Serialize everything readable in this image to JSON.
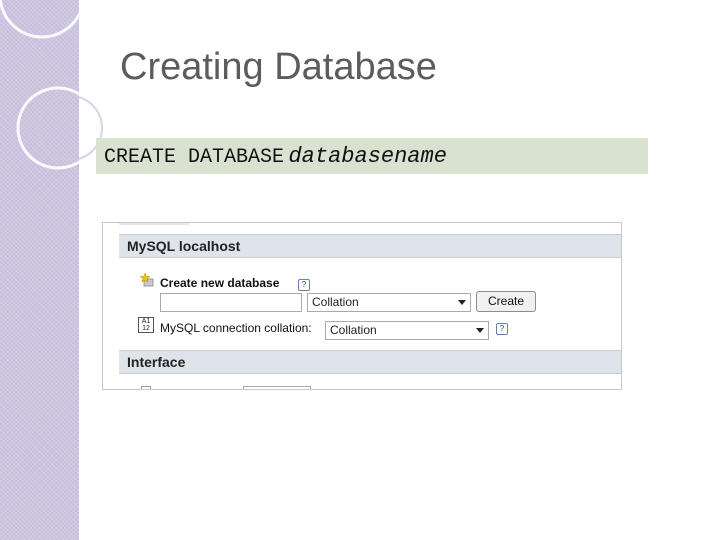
{
  "slide": {
    "title": "Creating Database",
    "code_keyword": "CREATE DATABASE",
    "code_argument": "databasename"
  },
  "screenshot": {
    "server_section": {
      "title": "MySQL localhost"
    },
    "create_db": {
      "label": "Create new database",
      "name_value": "",
      "collation_value": "Collation",
      "create_button": "Create",
      "help_text": "?"
    },
    "connection": {
      "label": "MySQL connection collation:",
      "collation_value": "Collation",
      "help_text": "?"
    },
    "interface_section": {
      "title": "Interface"
    }
  },
  "colors": {
    "sidebar": "#c6bfdc",
    "code_box": "#d9e1d1",
    "section_header": "#dfe3ea",
    "title_text": "#5c5c5c"
  },
  "icons": [
    "decorative-circles",
    "new-database-icon",
    "collation-az-icon",
    "help-icon",
    "dropdown-arrow-icon"
  ]
}
